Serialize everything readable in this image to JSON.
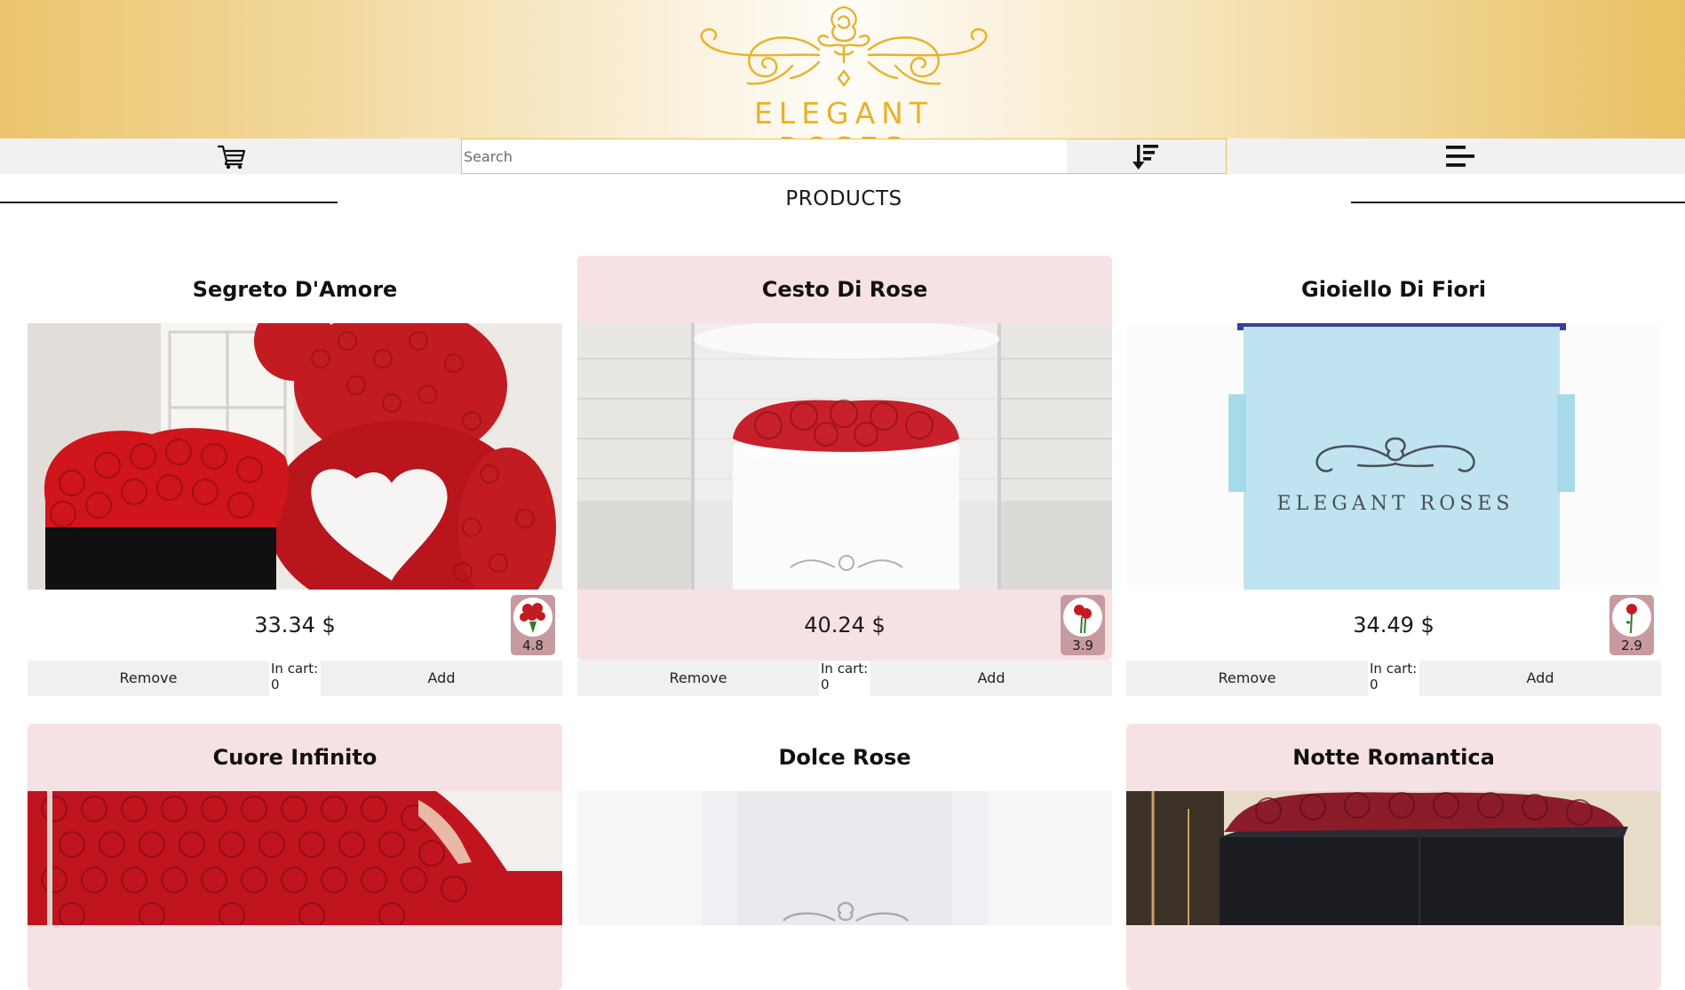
{
  "brand": {
    "logo_text": "ELEGANT ROSES",
    "accent": "#e7b22a"
  },
  "toolbar": {
    "cart_icon": "shopping-cart-icon",
    "search_placeholder": "Search",
    "search_value": "",
    "sort_icon": "sort-descending-icon",
    "menu_icon": "menu-icon"
  },
  "section": {
    "title": "PRODUCTS"
  },
  "products": [
    {
      "name": "Segreto D'Amore",
      "price": "33.34 $",
      "rating": "4.8",
      "in_cart_label": "In cart:",
      "in_cart": "0",
      "remove_label": "Remove",
      "add_label": "Add",
      "image": "rose-teddy-bear-and-heart-box"
    },
    {
      "name": "Cesto Di Rose",
      "price": "40.24 $",
      "rating": "3.9",
      "in_cart_label": "In cart:",
      "in_cart": "0",
      "remove_label": "Remove",
      "add_label": "Add",
      "image": "red-roses-in-glass-dome"
    },
    {
      "name": "Gioiello Di Fiori",
      "price": "34.49 $",
      "rating": "2.9",
      "in_cart_label": "In cart:",
      "in_cart": "0",
      "remove_label": "Remove",
      "add_label": "Add",
      "image": "light-blue-elegant-roses-box"
    },
    {
      "name": "Cuore Infinito",
      "image": "red-roses-heart-box"
    },
    {
      "name": "Dolce Rose",
      "image": "white-rose-box"
    },
    {
      "name": "Notte Romantica",
      "image": "red-roses-in-black-box"
    }
  ],
  "colors": {
    "card_highlight": "#f6e1e3",
    "rating_bg": "#c79aa0",
    "button_bg": "#f0f0f0"
  }
}
